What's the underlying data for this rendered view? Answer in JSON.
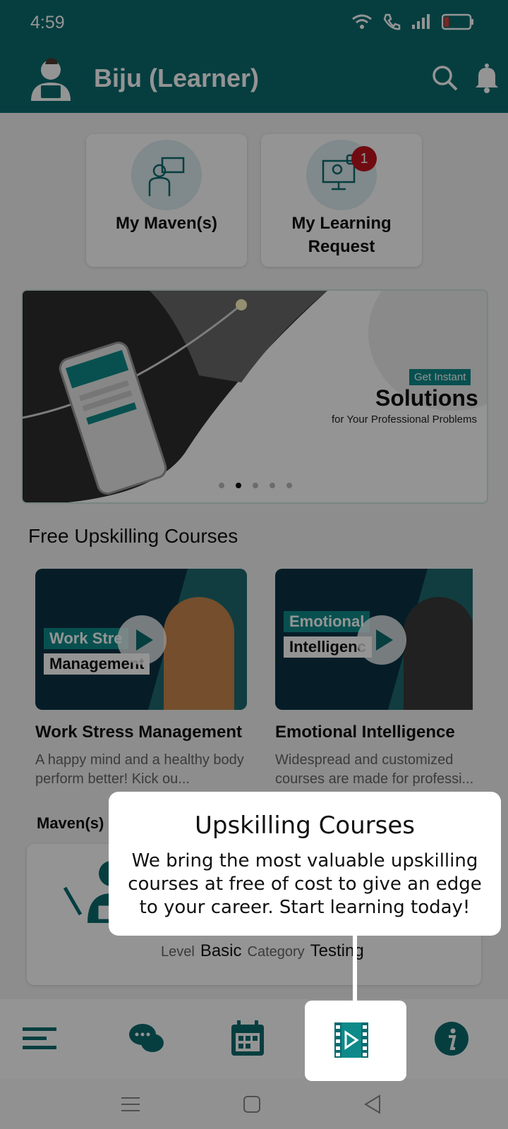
{
  "status_bar": {
    "time": "4:59"
  },
  "header": {
    "user_name": "Biju (Learner)"
  },
  "quick_cards": [
    {
      "label": "My Maven(s)"
    },
    {
      "label": "My Learning Request",
      "badge": "1"
    }
  ],
  "banner": {
    "tag": "Get Instant",
    "headline": "Solutions",
    "subline": "for Your Professional Problems",
    "active_slide": 2,
    "slide_count": 5
  },
  "courses_section": {
    "title": "Free Upskilling Courses",
    "items": [
      {
        "thumb_line1": "Work Stre",
        "thumb_line2": "Management",
        "title": "Work Stress Management",
        "description": "A happy mind and a healthy body perform better! Kick ou..."
      },
      {
        "thumb_line1": "Emotional",
        "thumb_line2": "Intelligenc",
        "title": "Emotional Intelligence",
        "description": "Widespread and customized courses are made for professi..."
      }
    ]
  },
  "mavens_section": {
    "title": "Maven(s)",
    "level_label": "Level",
    "level_value": "Basic",
    "category_label": "Category",
    "category_value": "Testing"
  },
  "bottom_nav": {
    "items": [
      "menu-icon",
      "chat-icon",
      "calendar-icon",
      "courses-video-icon",
      "info-icon"
    ],
    "active": "courses-video-icon"
  },
  "tooltip": {
    "title": "Upskilling Courses",
    "body": "We bring the most valuable upskilling courses at free of cost to give an edge to your career. Start learning today!"
  },
  "colors": {
    "primary": "#0b6b6f",
    "badge": "#c0161e",
    "accent": "#0e8a8a"
  }
}
